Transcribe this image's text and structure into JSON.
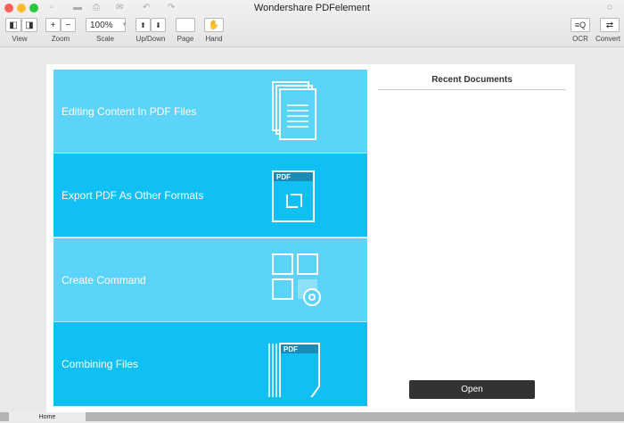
{
  "window": {
    "title": "Wondershare PDFelement"
  },
  "toolbar": {
    "view": "View",
    "zoom": "Zoom",
    "zoom_in": "+",
    "zoom_out": "−",
    "scale": "Scale",
    "scale_value": "100%",
    "updown": "Up/Down",
    "page": "Page",
    "hand": "Hand",
    "ocr": "OCR",
    "convert": "Convert"
  },
  "tiles": [
    {
      "label": "Editing Content In PDF Files",
      "color": "#5cd4f9"
    },
    {
      "label": "Export PDF As Other Formats",
      "color": "#10bff4"
    },
    {
      "label": "Create Command",
      "color": "#5cd4f9"
    },
    {
      "label": "Combining Files",
      "color": "#10bff4"
    }
  ],
  "icon_pdf": "PDF",
  "recent": {
    "title": "Recent Documents",
    "open_label": "Open"
  },
  "tabs": {
    "home": "Home"
  }
}
